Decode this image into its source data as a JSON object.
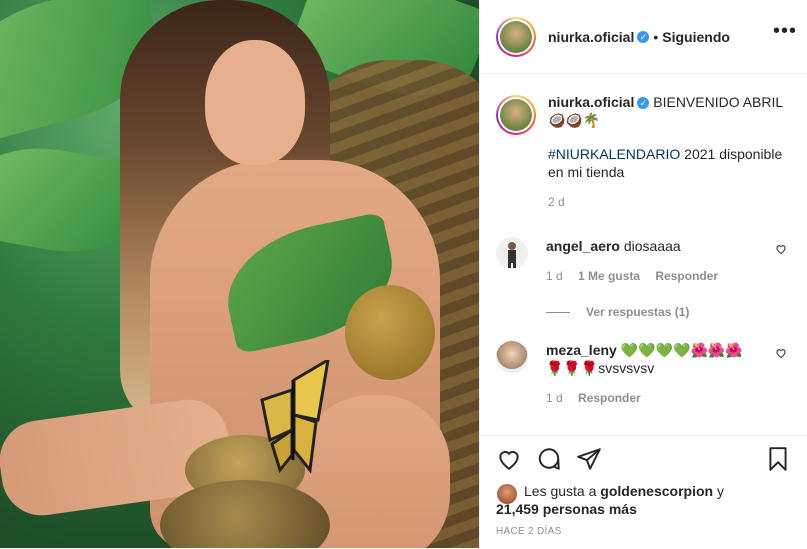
{
  "post": {
    "username": "niurka.oficial",
    "follow_separator": "•",
    "follow_status": "Siguiendo",
    "more_icon": "more-horizontal-icon"
  },
  "caption": {
    "username": "niurka.oficial",
    "line1": "BIENVENIDO ABRIL",
    "emojis": "🥥🥥🌴",
    "hashtag": "#NIURKALENDARIO",
    "line2_rest": " 2021 disponible en mi tienda",
    "time": "2 d"
  },
  "comments": [
    {
      "username": "angel_aero",
      "text": "diosaaaa",
      "time": "1 d",
      "likes": "1 Me gusta",
      "reply": "Responder",
      "view_replies": "Ver respuestas (1)"
    },
    {
      "username": "meza_leny",
      "text": "💚💚💚💚🌺🌺🌺",
      "text2": "🌹🌹🌹svsvsvsv",
      "time": "1 d",
      "reply": "Responder"
    }
  ],
  "actions": {
    "like_icon": "heart-icon",
    "comment_icon": "comment-icon",
    "share_icon": "send-icon",
    "save_icon": "bookmark-icon"
  },
  "likes": {
    "prefix": "Les gusta a ",
    "user": "goldenescorpion",
    "mid": " y",
    "count": "21,459 personas más"
  },
  "posted_ago": "HACE 2 DÍAS",
  "colors": {
    "verified": "#3897f0",
    "hashtag": "#00376b",
    "muted": "#8e8e8e"
  }
}
